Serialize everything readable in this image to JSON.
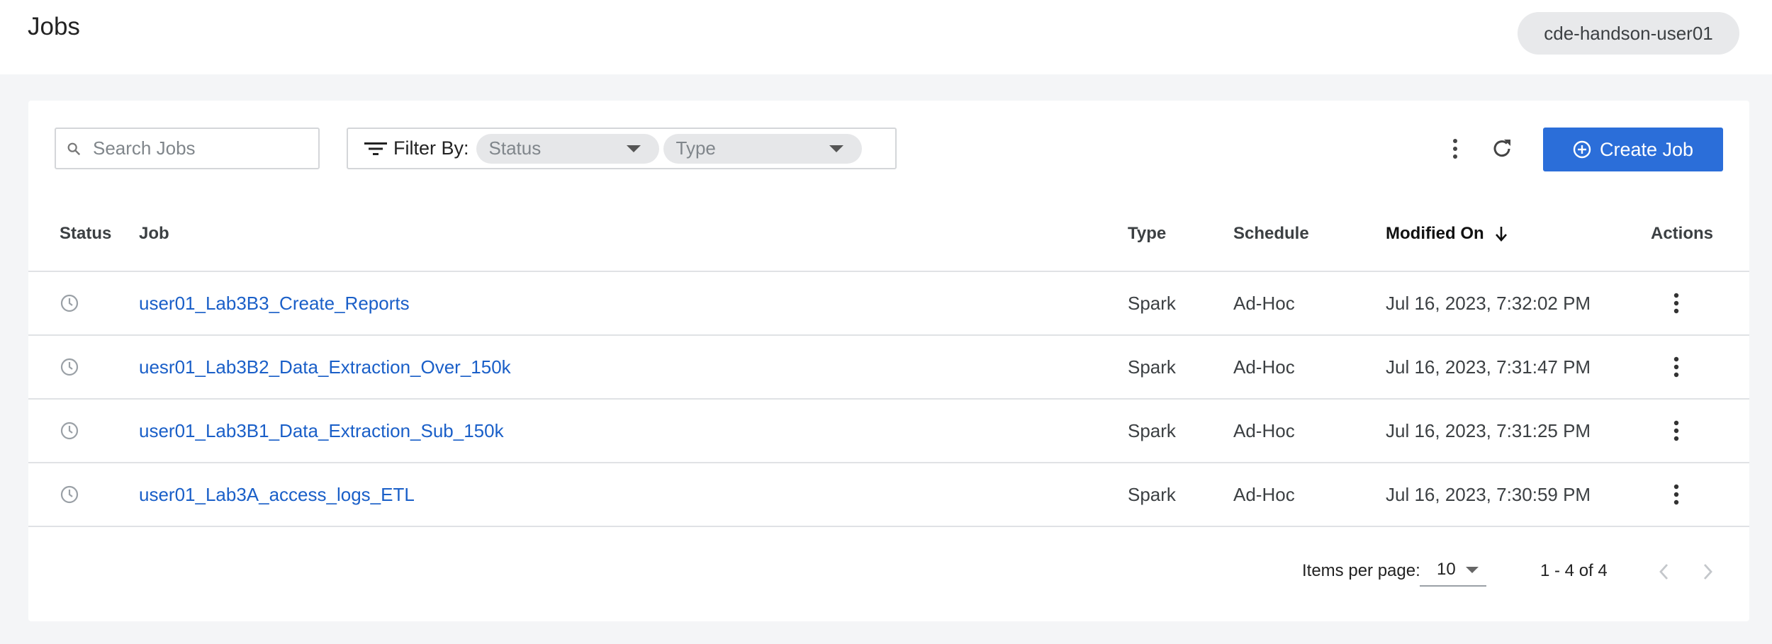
{
  "header": {
    "title": "Jobs",
    "user": "cde-handson-user01"
  },
  "toolbar": {
    "search_placeholder": "Search Jobs",
    "filter_label": "Filter By:",
    "filter_status": "Status",
    "filter_type": "Type",
    "create_label": "Create Job"
  },
  "table": {
    "columns": {
      "status": "Status",
      "job": "Job",
      "type": "Type",
      "schedule": "Schedule",
      "modified": "Modified On",
      "actions": "Actions"
    },
    "rows": [
      {
        "job": "user01_Lab3B3_Create_Reports",
        "type": "Spark",
        "schedule": "Ad-Hoc",
        "modified": "Jul 16, 2023, 7:32:02 PM"
      },
      {
        "job": "uesr01_Lab3B2_Data_Extraction_Over_150k",
        "type": "Spark",
        "schedule": "Ad-Hoc",
        "modified": "Jul 16, 2023, 7:31:47 PM"
      },
      {
        "job": "user01_Lab3B1_Data_Extraction_Sub_150k",
        "type": "Spark",
        "schedule": "Ad-Hoc",
        "modified": "Jul 16, 2023, 7:31:25 PM"
      },
      {
        "job": "user01_Lab3A_access_logs_ETL",
        "type": "Spark",
        "schedule": "Ad-Hoc",
        "modified": "Jul 16, 2023, 7:30:59 PM"
      }
    ]
  },
  "pagination": {
    "items_label": "Items per page:",
    "items_value": "10",
    "range": "1 - 4 of 4"
  },
  "colors": {
    "accent": "#2b6ed9",
    "link": "#1a5fc8"
  }
}
